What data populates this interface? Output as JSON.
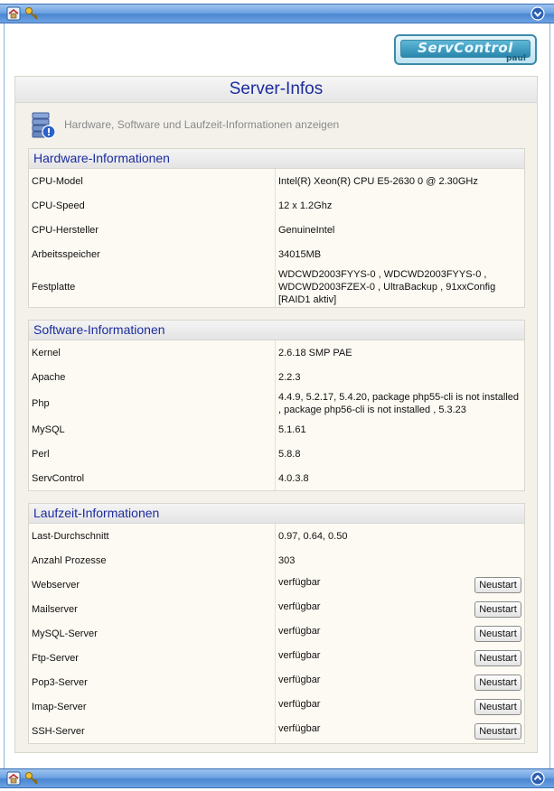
{
  "page_title": "Server-Infos",
  "subtitle": "Hardware, Software und Laufzeit-Informationen anzeigen",
  "logo": {
    "main": "ServControl",
    "sub": "paul"
  },
  "hardware": {
    "title": "Hardware-Informationen",
    "rows": [
      {
        "label": "CPU-Model",
        "value": "Intel(R) Xeon(R) CPU E5-2630 0 @ 2.30GHz"
      },
      {
        "label": "CPU-Speed",
        "value": "12 x 1.2Ghz"
      },
      {
        "label": "CPU-Hersteller",
        "value": "GenuineIntel"
      },
      {
        "label": "Arbeitsspeicher",
        "value": "34015MB"
      },
      {
        "label": "Festplatte",
        "value": "WDCWD2003FYYS-0 , WDCWD2003FYYS-0 , WDCWD2003FZEX-0 , UltraBackup , 91xxConfig [RAID1 aktiv]"
      }
    ]
  },
  "software": {
    "title": "Software-Informationen",
    "rows": [
      {
        "label": "Kernel",
        "value": "2.6.18 SMP PAE"
      },
      {
        "label": "Apache",
        "value": "2.2.3"
      },
      {
        "label": "Php",
        "value": "4.4.9, 5.2.17, 5.4.20, package php55-cli is not installed , package php56-cli is not installed , 5.3.23"
      },
      {
        "label": "MySQL",
        "value": "5.1.61"
      },
      {
        "label": "Perl",
        "value": "5.8.8"
      },
      {
        "label": "ServControl",
        "value": "4.0.3.8"
      }
    ]
  },
  "runtime": {
    "title": "Laufzeit-Informationen",
    "rows": [
      {
        "label": "Last-Durchschnitt",
        "value": "0.97, 0.64, 0.50"
      },
      {
        "label": "Anzahl Prozesse",
        "value": "303"
      },
      {
        "label": "Webserver",
        "value": "verfügbar",
        "button": "Neustart"
      },
      {
        "label": "Mailserver",
        "value": "verfügbar",
        "button": "Neustart"
      },
      {
        "label": "MySQL-Server",
        "value": "verfügbar",
        "button": "Neustart"
      },
      {
        "label": "Ftp-Server",
        "value": "verfügbar",
        "button": "Neustart"
      },
      {
        "label": "Pop3-Server",
        "value": "verfügbar",
        "button": "Neustart"
      },
      {
        "label": "Imap-Server",
        "value": "verfügbar",
        "button": "Neustart"
      },
      {
        "label": "SSH-Server",
        "value": "verfügbar",
        "button": "Neustart"
      }
    ]
  },
  "icons": {
    "top_left": [
      "home-icon",
      "key-icon"
    ],
    "top_right": "arrow-down-icon",
    "bottom_left": [
      "home-icon",
      "key-icon"
    ],
    "bottom_right": "arrow-up-icon",
    "subtitle": "server-info-icon"
  }
}
